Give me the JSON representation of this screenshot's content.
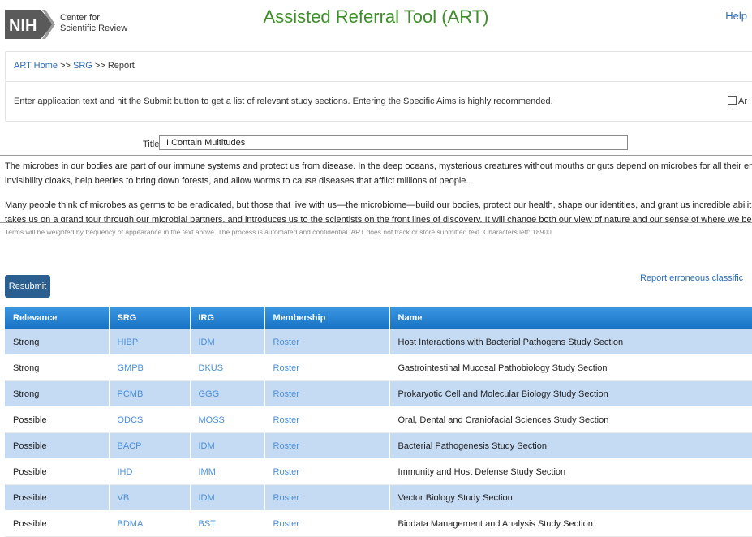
{
  "header": {
    "logo_text": "NIH",
    "center_name_line1": "Center for",
    "center_name_line2": "Scientific Review",
    "title": "Assisted Referral Tool (ART)",
    "help": "Help"
  },
  "breadcrumb": {
    "home": "ART Home",
    "sep1": ">>",
    "srg": "SRG",
    "sep2": ">>",
    "current": "Report"
  },
  "instructions": {
    "text": "Enter application text and hit the Submit button to get a list of relevant study sections. Entering the Specific Aims is highly recommended.",
    "checkbox_label": "Ar"
  },
  "title_field": {
    "label": "Title",
    "value": "I Contain Multitudes"
  },
  "abstract": {
    "paragraph1": "The microbes in our bodies are part of our immune systems and protect us from disease. In the deep oceans, mysterious creatures without mouths or guts depend on microbes for all their energy. Bacteria provide squid wi",
    "paragraph1_line2": "invisibility cloaks, help beetles to bring down forests, and allow worms to cause diseases that afflict millions of people.",
    "paragraph2": "Many people think of microbes as germs to be eradicated, but those that live with us—the microbiome—build our bodies, protect our health, shape our identities, and grant us incredible abilities. In this astonishing book, Ed",
    "paragraph2_line2": "takes us on a grand tour through our microbial partners, and introduces us to the scientists on the front lines of discovery. It will change both our view of nature and our sense of where we belong in it."
  },
  "terms": "Terms will be weighted by frequency of appearance in the text above. The process is automated and confidential. ART does not track or store submitted text.   Characters left: 18900",
  "actions": {
    "resubmit": "Resubmit",
    "report": "Report erroneous classific"
  },
  "table": {
    "headers": [
      "Relevance",
      "SRG",
      "IRG",
      "Membership",
      "Name"
    ],
    "rows": [
      {
        "relevance": "Strong",
        "srg": "HIBP",
        "irg": "IDM",
        "membership": "Roster",
        "name": "Host Interactions with Bacterial Pathogens Study Section"
      },
      {
        "relevance": "Strong",
        "srg": "GMPB",
        "irg": "DKUS",
        "membership": "Roster",
        "name": "Gastrointestinal Mucosal Pathobiology Study Section"
      },
      {
        "relevance": "Strong",
        "srg": "PCMB",
        "irg": "GGG",
        "membership": "Roster",
        "name": "Prokaryotic Cell and Molecular Biology Study Section"
      },
      {
        "relevance": "Possible",
        "srg": "ODCS",
        "irg": "MOSS",
        "membership": "Roster",
        "name": "Oral, Dental and Craniofacial Sciences Study Section"
      },
      {
        "relevance": "Possible",
        "srg": "BACP",
        "irg": "IDM",
        "membership": "Roster",
        "name": "Bacterial Pathogenesis Study Section"
      },
      {
        "relevance": "Possible",
        "srg": "IHD",
        "irg": "IMM",
        "membership": "Roster",
        "name": "Immunity and Host Defense Study Section"
      },
      {
        "relevance": "Possible",
        "srg": "VB",
        "irg": "IDM",
        "membership": "Roster",
        "name": "Vector Biology Study Section"
      },
      {
        "relevance": "Possible",
        "srg": "BDMA",
        "irg": "BST",
        "membership": "Roster",
        "name": "Biodata Management and Analysis Study Section"
      }
    ]
  },
  "colors": {
    "title_green": "#3e8e2a",
    "link_blue": "#2b6cb8",
    "table_header": "#1e7fd0",
    "row_highlight": "#c5daf3",
    "button": "#2a5f8f"
  }
}
